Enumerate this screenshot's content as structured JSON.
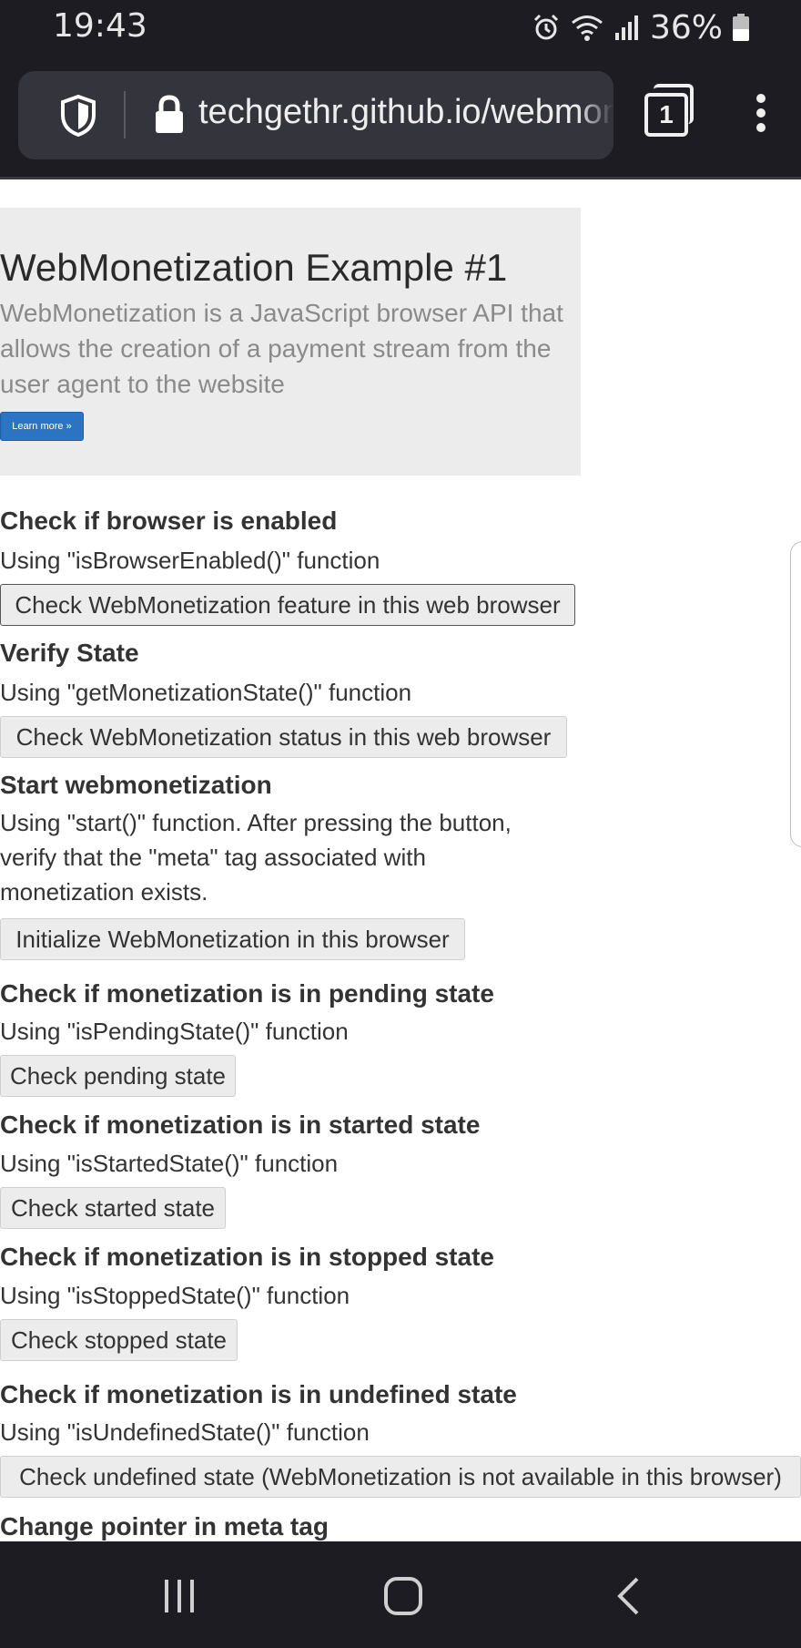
{
  "status_bar": {
    "time": "19:43",
    "battery": "36%",
    "icons": [
      "alarm-icon",
      "wifi-icon",
      "signal-icon",
      "battery-icon"
    ]
  },
  "browser": {
    "url": "techgethr.github.io/webmonetization",
    "tab_count": "1",
    "icons": [
      "shield-icon",
      "lock-icon",
      "tabs-icon",
      "menu-icon"
    ]
  },
  "hero": {
    "title": "WebMonetization Example #1",
    "description": "WebMonetization is a JavaScript browser API that allows the creation of a payment stream from the user agent to the website",
    "learn_more": "Learn more »",
    "button_color": "#2b74c4"
  },
  "sections": [
    {
      "title": "Check if browser is enabled",
      "desc": "Using \"isBrowserEnabled()\" function",
      "button": "Check WebMonetization feature in this web browser"
    },
    {
      "title": "Verify State",
      "desc": "Using \"getMonetizationState()\" function",
      "button": "Check WebMonetization status in this web browser"
    },
    {
      "title": "Start webmonetization",
      "desc": "Using \"start()\" function. After pressing the button, verify that the \"meta\" tag associated with monetization exists.",
      "button": "Initialize WebMonetization in this browser"
    },
    {
      "title": "Check if monetization is in pending state",
      "desc": "Using \"isPendingState()\" function",
      "button": "Check pending state"
    },
    {
      "title": "Check if monetization is in started state",
      "desc": "Using \"isStartedState()\" function",
      "button": "Check started state"
    },
    {
      "title": "Check if monetization is in stopped state",
      "desc": "Using \"isStoppedState()\" function",
      "button": "Check stopped state"
    },
    {
      "title": "Check if monetization is in undefined state",
      "desc": "Using \"isUndefinedState()\" function",
      "button": "Check undefined state (WebMonetization is not available in this browser)"
    },
    {
      "title": "Change pointer in meta tag"
    }
  ],
  "nav_bar": {
    "icons": [
      "recent-apps-icon",
      "home-icon",
      "back-icon"
    ]
  }
}
